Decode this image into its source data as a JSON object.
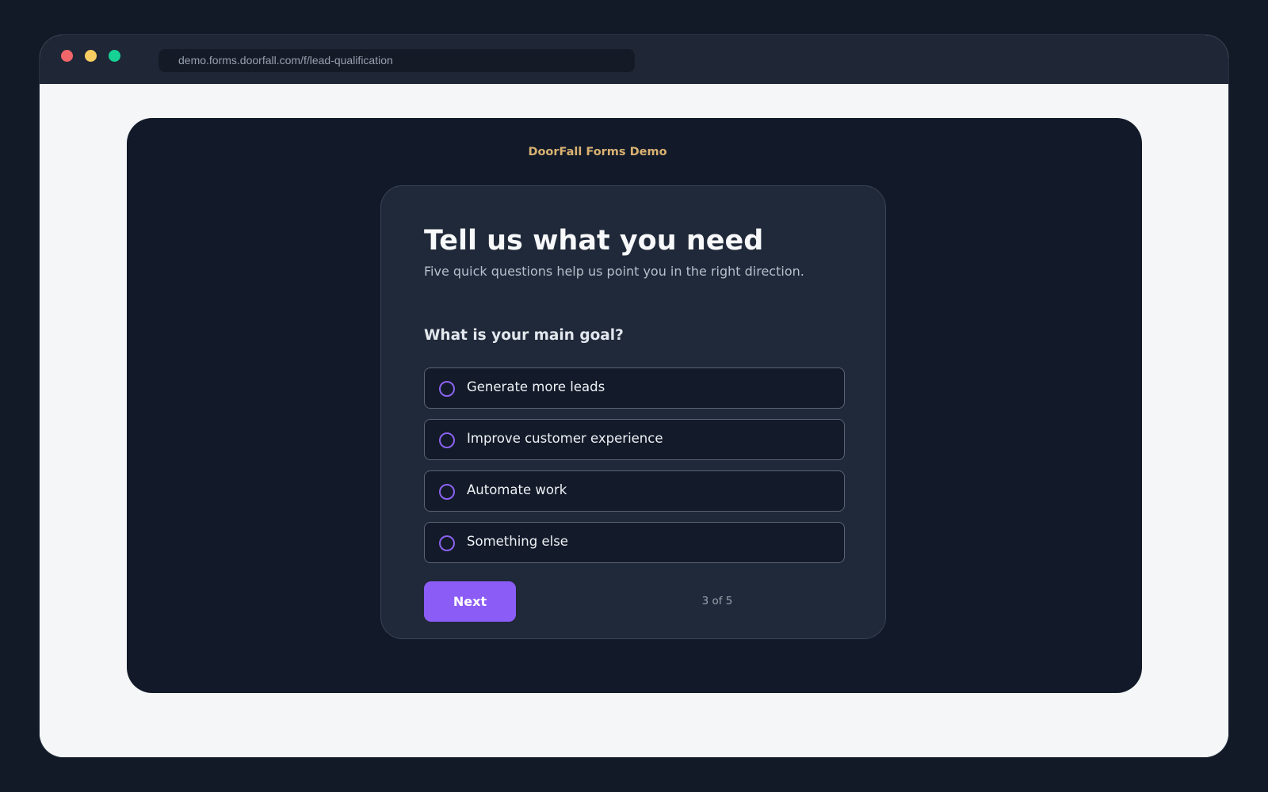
{
  "browser": {
    "address": "demo.forms.doorfall.com/f/lead-qualification",
    "traffic_lights": {
      "close_color": "#f26569",
      "minimize_color": "#f8ce63",
      "maximize_color": "#16d294"
    }
  },
  "page": {
    "brand": "DoorFall Forms Demo",
    "brand_color": "#d9b272",
    "panel_color": "#121a29",
    "background_color": "#f4f6f8"
  },
  "form": {
    "title": "Tell us what you need",
    "subtitle": "Five quick questions help us point you in the right direction.",
    "question": "What is your main goal?",
    "options": [
      {
        "label": "Generate more leads",
        "selected": false,
        "icon": "radio-unchecked-icon"
      },
      {
        "label": "Improve customer experience",
        "selected": false,
        "icon": "radio-unchecked-icon"
      },
      {
        "label": "Automate work",
        "selected": false,
        "icon": "radio-unchecked-icon"
      },
      {
        "label": "Something else",
        "selected": false,
        "icon": "radio-unchecked-icon"
      }
    ],
    "next_label": "Next",
    "progress_text": "3 of 5",
    "accent_color": "#8b5cf6"
  }
}
